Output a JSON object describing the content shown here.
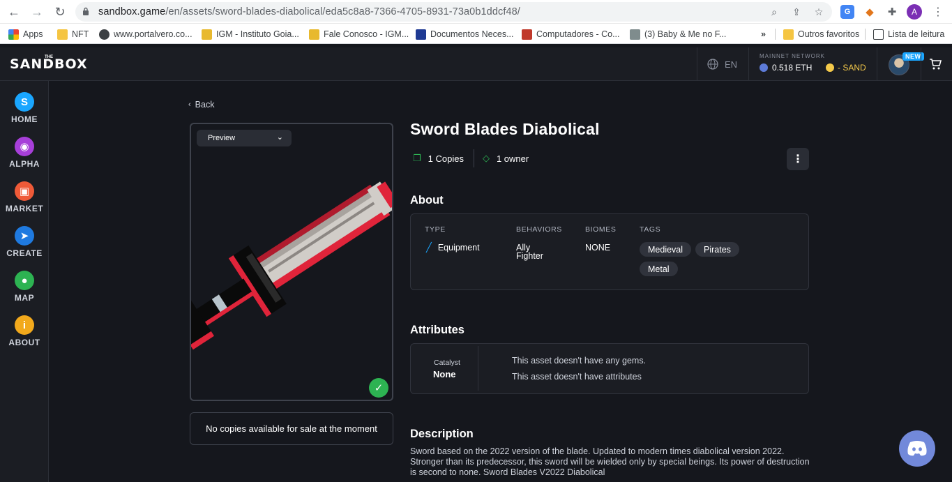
{
  "browser": {
    "url_host": "sandbox.game",
    "url_path": "/en/assets/sword-blades-diabolical/eda5c8a8-7366-4705-8931-73a0b1ddcf48/",
    "profile_initial": "A",
    "bookmarks": [
      {
        "label": "Apps",
        "icon": "apps-grid-icon"
      },
      {
        "label": "NFT",
        "icon": "folder-icon"
      },
      {
        "label": "www.portalvero.co...",
        "icon": "globe-icon"
      },
      {
        "label": "IGM - Instituto Goia...",
        "icon": "site-icon"
      },
      {
        "label": "Fale Conosco - IGM...",
        "icon": "site-icon"
      },
      {
        "label": "Documentos Neces...",
        "icon": "site-icon"
      },
      {
        "label": "Computadores - Co...",
        "icon": "site-icon"
      },
      {
        "label": "(3) Baby & Me no F...",
        "icon": "site-icon"
      },
      {
        "label": "»",
        "icon": ""
      },
      {
        "label": "Outros favoritos",
        "icon": "folder-icon"
      },
      {
        "label": "Lista de leitura",
        "icon": "reading-list-icon"
      }
    ]
  },
  "header": {
    "logo_the": "THE",
    "logo": "SANDBOX",
    "language": "EN",
    "network_label": "MAINNET NETWORK",
    "eth_balance": "0.518 ETH",
    "sand_balance": "- SAND",
    "new_badge": "NEW"
  },
  "sidebar": {
    "items": [
      {
        "label": "HOME",
        "glyph": "S",
        "color": "#1aa6ff"
      },
      {
        "label": "ALPHA",
        "glyph": "◉",
        "color": "#a73fd9"
      },
      {
        "label": "MARKET",
        "glyph": "▣",
        "color": "#ef5a38"
      },
      {
        "label": "CREATE",
        "glyph": "➤",
        "color": "#1f7ae0"
      },
      {
        "label": "MAP",
        "glyph": "●",
        "color": "#2db352"
      },
      {
        "label": "ABOUT",
        "glyph": "i",
        "color": "#f2a91c"
      }
    ]
  },
  "asset": {
    "back_label": "Back",
    "preview_label": "Preview",
    "no_copies": "No copies available for sale at the moment",
    "title": "Sword Blades Diabolical",
    "copies": "1 Copies",
    "owners": "1 owner"
  },
  "about": {
    "heading": "About",
    "type_header": "TYPE",
    "type_value": "Equipment",
    "behaviors_header": "BEHAVIORS",
    "behaviors_value_line1": "Ally",
    "behaviors_value_line2": "Fighter",
    "biomes_header": "BIOMES",
    "biomes_value": "NONE",
    "tags_header": "TAGS",
    "tags": [
      "Medieval",
      "Pirates",
      "Metal"
    ]
  },
  "attributes": {
    "heading": "Attributes",
    "catalyst_label": "Catalyst",
    "catalyst_value": "None",
    "gems_text": "This asset doesn't have any gems.",
    "attributes_text": "This asset doesn't have attributes"
  },
  "description": {
    "heading": "Description",
    "text": "Sword based on the 2022 version of the blade. Updated to modern times diabolical version 2022. Stronger than its predecessor, this sword will be wielded only by special beings. Its power of destruction is second to none. Sword Blades V2022 Diabolical"
  }
}
